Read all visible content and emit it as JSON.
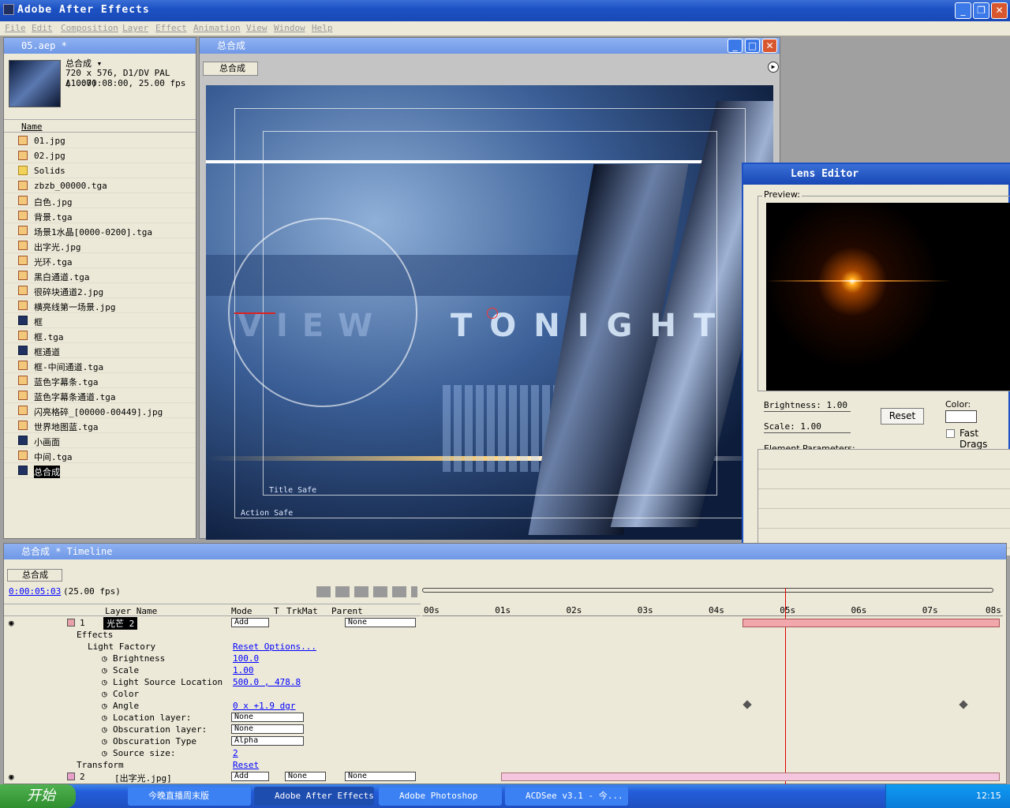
{
  "app": {
    "title": "Adobe After Effects"
  },
  "menu": [
    "File",
    "Edit",
    "Composition",
    "Layer",
    "Effect",
    "Animation",
    "View",
    "Window",
    "Help"
  ],
  "project": {
    "title": "05.aep *",
    "comp_name": "总合成 ▾",
    "info1": "720 x 576, D1/DV PAL (1.07)",
    "info2": "Δ 0:00:08:00, 25.00 fps",
    "name_header": "Name",
    "items": [
      "01.jpg",
      "02.jpg",
      "Solids",
      "zbzb_00000.tga",
      "白色.jpg",
      "背景.tga",
      "场景1水晶[0000-0200].tga",
      "出字光.jpg",
      "光环.tga",
      "黑白通道.tga",
      "很碎块通道2.jpg",
      "横亮线第一场景.jpg",
      "框",
      "框.tga",
      "框通道",
      "框-中间通道.tga",
      "蓝色字幕条.tga",
      "蓝色字幕条通道.tga",
      "闪亮格碎_[00000-00449].jpg",
      "世界地图蓝.tga",
      "小画面",
      "中间.tga",
      "总合成"
    ]
  },
  "comp": {
    "title": "总合成",
    "tab": "总合成",
    "title_safe": "Title Safe",
    "action_safe": "Action Safe",
    "word1": "VIEW",
    "word2": "TONIGHT"
  },
  "lens": {
    "title": "Lens Editor",
    "preview": "Preview:",
    "brightness": "Brightness: 1.00",
    "scale": "Scale: 1.00",
    "reset": "Reset",
    "color": "Color:",
    "fast": "Fast Drags",
    "element": "Element Parameters:"
  },
  "timeline": {
    "title": "总合成 * Timeline",
    "tab": "总合成",
    "time": "0:00:05:03",
    "fps": "(25.00 fps)",
    "headers": {
      "layer": "Layer Name",
      "mode": "Mode",
      "t": "T",
      "trkmat": "TrkMat",
      "parent": "Parent"
    },
    "ruler": [
      "00s",
      "01s",
      "02s",
      "03s",
      "04s",
      "05s",
      "06s",
      "07s",
      "08s"
    ],
    "layer1": {
      "num": "1",
      "name": "光芒 2",
      "mode": "Add",
      "parent": "None"
    },
    "effects": "Effects",
    "lf": "Light Factory",
    "reset_opts": "Reset Options...",
    "props": [
      {
        "n": "Brightness",
        "v": "100.0"
      },
      {
        "n": "Scale",
        "v": "1.00"
      },
      {
        "n": "Light Source Location",
        "v": "500.0 , 478.8"
      },
      {
        "n": "Color",
        "v": ""
      },
      {
        "n": "Angle",
        "v": "0 x +1.9 dgr"
      },
      {
        "n": "Location layer:",
        "v": "None"
      },
      {
        "n": "Obscuration layer:",
        "v": "None"
      },
      {
        "n": "Obscuration Type",
        "v": "Alpha"
      },
      {
        "n": "Source size:",
        "v": "2"
      }
    ],
    "transform": "Transform",
    "transform_reset": "Reset",
    "layer2": {
      "num": "2",
      "name": "[出字光.jpg]",
      "mode": "Add",
      "trk": "None",
      "parent": "None"
    }
  },
  "taskbar": {
    "start": "开始",
    "tasks": [
      "今晚直播周末版",
      "Adobe After Effects",
      "Adobe Photoshop",
      "ACDSee v3.1 - 今..."
    ],
    "clock": "12:15"
  }
}
